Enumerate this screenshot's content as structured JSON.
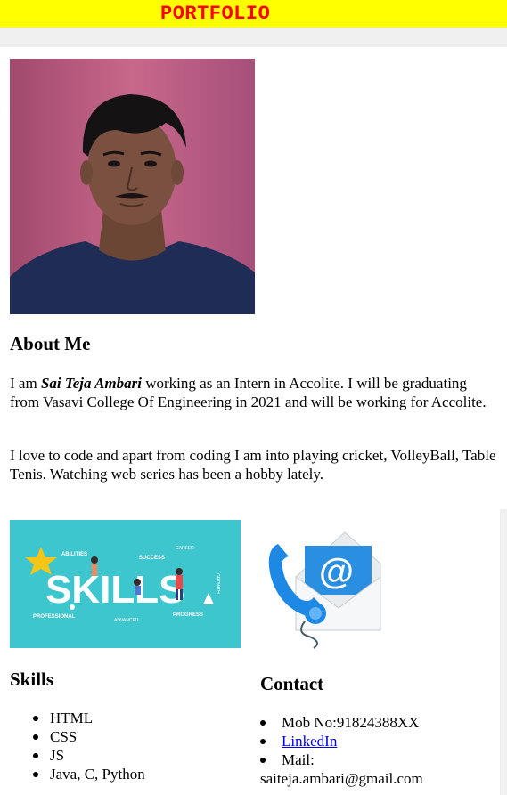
{
  "header": {
    "title": "PORTFOLIO"
  },
  "about": {
    "title": "About Me",
    "p1_pre": "I am ",
    "name": "Sai Teja Ambari",
    "p1_post": " working as an Intern in Accolite. I will be graduating from Vasavi College Of Engineering in 2021 and will be working for Accolite.",
    "p2": "I love to code and apart from coding I am into playing cricket, VolleyBall, Table Tenis. Watching web series has been a hobby lately."
  },
  "skills": {
    "title": "Skills",
    "image_words": [
      "ABILITIES",
      "SUCCESS",
      "CAREER",
      "SKILLS",
      "GROWTH",
      "PROFESSIONAL",
      "ADVANCED",
      "PROGRESS"
    ],
    "items": [
      "HTML",
      "CSS",
      "JS",
      "Java, C, Python"
    ]
  },
  "contact": {
    "title": "Contact",
    "mob": "Mob No:91824388XX",
    "linkedin": "LinkedIn",
    "mail_label": "Mail:",
    "mail": "saiteja.ambari@gmail.com",
    "image_symbol": "@"
  },
  "colors": {
    "header_bg": "#ffff00",
    "header_text": "#ff0000",
    "link": "#0000ee",
    "skills_bg": "#3ec6cf"
  }
}
